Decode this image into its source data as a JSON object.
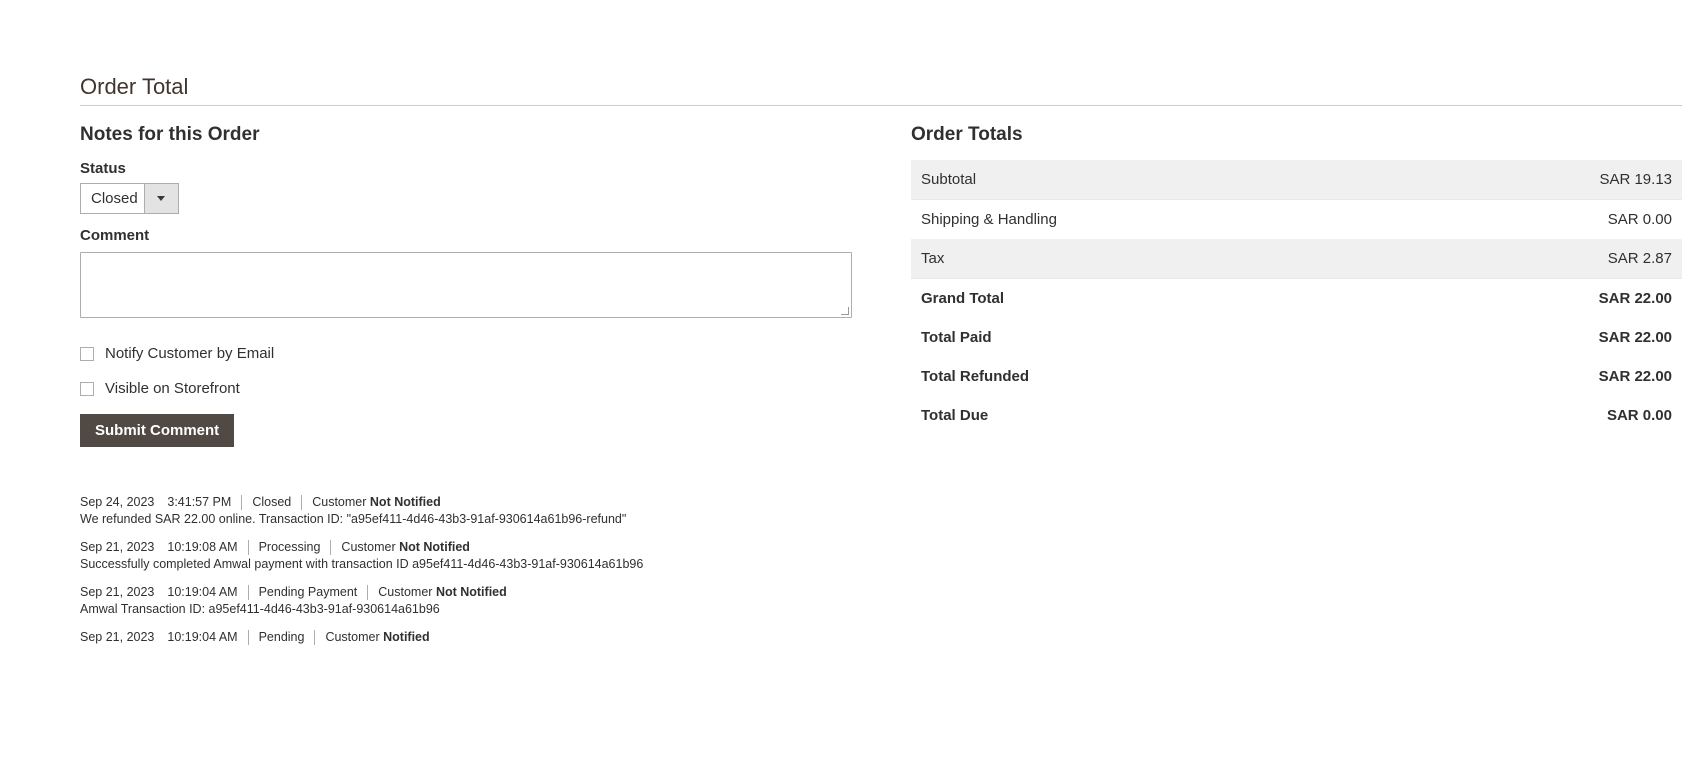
{
  "section": {
    "title": "Order Total"
  },
  "notes": {
    "heading": "Notes for this Order",
    "status_label": "Status",
    "status_value": "Closed",
    "comment_label": "Comment",
    "comment_value": "",
    "notify_label": "Notify Customer by Email",
    "visible_label": "Visible on Storefront",
    "submit_label": "Submit Comment"
  },
  "history": [
    {
      "date": "Sep 24, 2023",
      "time": "3:41:57 PM",
      "status": "Closed",
      "customer_prefix": "Customer",
      "customer_status": "Not Notified",
      "comment": "We refunded SAR 22.00 online. Transaction ID: \"a95ef411-4d46-43b3-91af-930614a61b96-refund\""
    },
    {
      "date": "Sep 21, 2023",
      "time": "10:19:08 AM",
      "status": "Processing",
      "customer_prefix": "Customer",
      "customer_status": "Not Notified",
      "comment": "Successfully completed Amwal payment with transaction ID a95ef411-4d46-43b3-91af-930614a61b96"
    },
    {
      "date": "Sep 21, 2023",
      "time": "10:19:04 AM",
      "status": "Pending Payment",
      "customer_prefix": "Customer",
      "customer_status": "Not Notified",
      "comment": "Amwal Transaction ID: a95ef411-4d46-43b3-91af-930614a61b96"
    },
    {
      "date": "Sep 21, 2023",
      "time": "10:19:04 AM",
      "status": "Pending",
      "customer_prefix": "Customer",
      "customer_status": "Notified",
      "comment": ""
    }
  ],
  "totals": {
    "heading": "Order Totals",
    "rows": [
      {
        "label": "Subtotal",
        "amount": "SAR 19.13"
      },
      {
        "label": "Shipping & Handling",
        "amount": "SAR 0.00"
      },
      {
        "label": "Tax",
        "amount": "SAR 2.87"
      },
      {
        "label": "Grand Total",
        "amount": "SAR 22.00"
      },
      {
        "label": "Total Paid",
        "amount": "SAR 22.00"
      },
      {
        "label": "Total Refunded",
        "amount": "SAR 22.00"
      },
      {
        "label": "Total Due",
        "amount": "SAR 0.00"
      }
    ]
  }
}
